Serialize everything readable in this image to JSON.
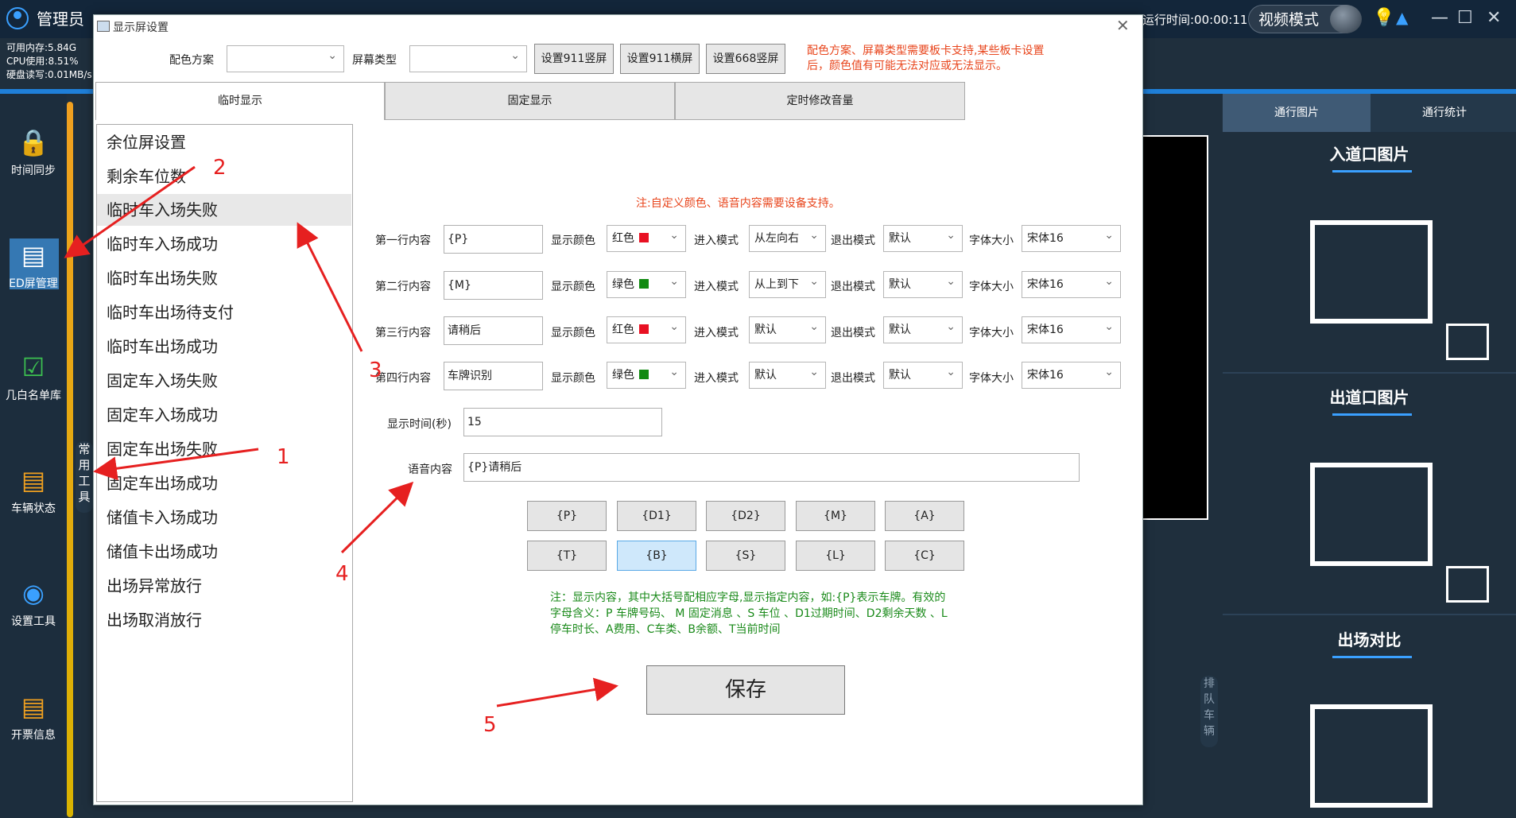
{
  "app": {
    "user": "管理员",
    "sysinfo": [
      "可用内存:5.84G",
      "CPU使用:8.51%",
      "硬盘读写:0.01MB/s"
    ],
    "runtime": "运行时间:00:00:11",
    "mode": "视频模式"
  },
  "leftnav": {
    "items": [
      {
        "label": "时间同步",
        "icon": "clock-lock-icon"
      },
      {
        "label": "ED屏管理",
        "icon": "led-screen-icon"
      },
      {
        "label": "几白名单库",
        "icon": "clipboard-check-icon"
      },
      {
        "label": "车辆状态",
        "icon": "vehicle-status-icon"
      },
      {
        "label": "设置工具",
        "icon": "broadcast-icon"
      },
      {
        "label": "开票信息",
        "icon": "invoice-icon"
      }
    ],
    "side_tab": "常用工具"
  },
  "right": {
    "tabs": [
      "通行图片",
      "通行统计"
    ],
    "sections": [
      "入道口图片",
      "出道口图片",
      "出场对比"
    ],
    "side_tab": "排队车辆"
  },
  "dialog": {
    "title": "显示屏设置",
    "color_scheme_label": "配色方案",
    "color_scheme_value": "",
    "screen_type_label": "屏幕类型",
    "screen_type_value": "",
    "buttons": [
      "设置911竖屏",
      "设置911横屏",
      "设置668竖屏"
    ],
    "warning": "配色方案、屏幕类型需要板卡支持,某些板卡设置后，颜色值有可能无法对应或无法显示。",
    "tabs": [
      "临时显示",
      "固定显示",
      "定时修改音量"
    ],
    "list": [
      "余位屏设置",
      "剩余车位数",
      "临时车入场失败",
      "临时车入场成功",
      "临时车出场失败",
      "临时车出场待支付",
      "临时车出场成功",
      "固定车入场失败",
      "固定车入场成功",
      "固定车出场失败",
      "固定车出场成功",
      "储值卡入场成功",
      "储值卡出场成功",
      "出场异常放行",
      "出场取消放行"
    ],
    "custom_note": "注:自定义颜色、语音内容需要设备支持。",
    "field_labels": {
      "color": "显示颜色",
      "enter": "进入模式",
      "exit": "退出模式",
      "font": "字体大小"
    },
    "rows": [
      {
        "label": "第一行内容",
        "content": "{P}",
        "color": "红色",
        "color_hex": "#e81123",
        "enter": "从左向右",
        "exit": "默认",
        "font": "宋体16"
      },
      {
        "label": "第二行内容",
        "content": "{M}",
        "color": "绿色",
        "color_hex": "#108a10",
        "enter": "从上到下",
        "exit": "默认",
        "font": "宋体16"
      },
      {
        "label": "第三行内容",
        "content": "请稍后",
        "color": "红色",
        "color_hex": "#e81123",
        "enter": "默认",
        "exit": "默认",
        "font": "宋体16"
      },
      {
        "label": "第四行内容",
        "content": "车牌识别",
        "color": "绿色",
        "color_hex": "#108a10",
        "enter": "默认",
        "exit": "默认",
        "font": "宋体16"
      }
    ],
    "duration_label": "显示时间(秒)",
    "duration_value": "15",
    "voice_label": "语音内容",
    "voice_value": "{P}请稍后",
    "tokens": [
      "{P}",
      "{D1}",
      "{D2}",
      "{M}",
      "{A}",
      "{T}",
      "{B}",
      "{S}",
      "{L}",
      "{C}"
    ],
    "token_note": "注：显示内容，其中大括号配相应字母,显示指定内容，如:{P}表示车牌。有效的字母含义：P 车牌号码、 M 固定消息 、S 车位 、D1过期时间、D2剩余天数 、L停车时长、A费用、C车类、B余额、T当前时间",
    "save": "保存"
  },
  "annotations": [
    "1",
    "2",
    "3",
    "4",
    "5"
  ]
}
